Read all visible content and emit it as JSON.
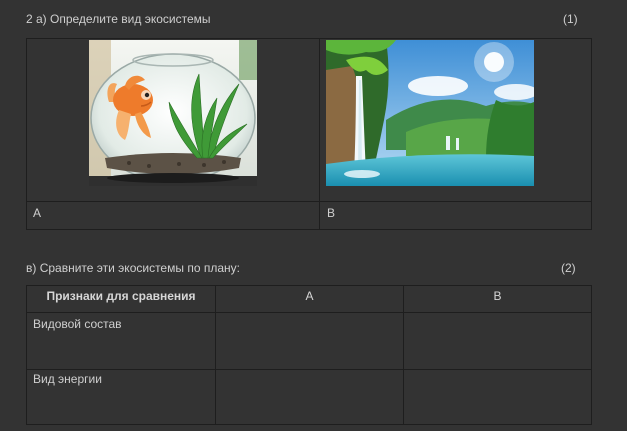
{
  "task_a": {
    "title": "2 а)  Определите вид экосистемы",
    "points": "(1)",
    "labels": [
      "A",
      "B"
    ]
  },
  "task_b": {
    "title": "в) Сравните эти экосистемы по плану:",
    "points": "(2)",
    "table": {
      "headers": [
        "Признаки для сравнения",
        "A",
        "B"
      ],
      "rows": [
        {
          "label": "Видовой состав",
          "a": "",
          "b": ""
        },
        {
          "label": "Вид энергии",
          "a": "",
          "b": ""
        }
      ]
    }
  },
  "images": [
    {
      "icon": "aquarium-goldfish-photo"
    },
    {
      "icon": "waterfall-lake-landscape-photo"
    }
  ],
  "colors": {
    "background": "#333333",
    "text": "#cfcfcf",
    "grid_line": "#1e1e1e"
  }
}
